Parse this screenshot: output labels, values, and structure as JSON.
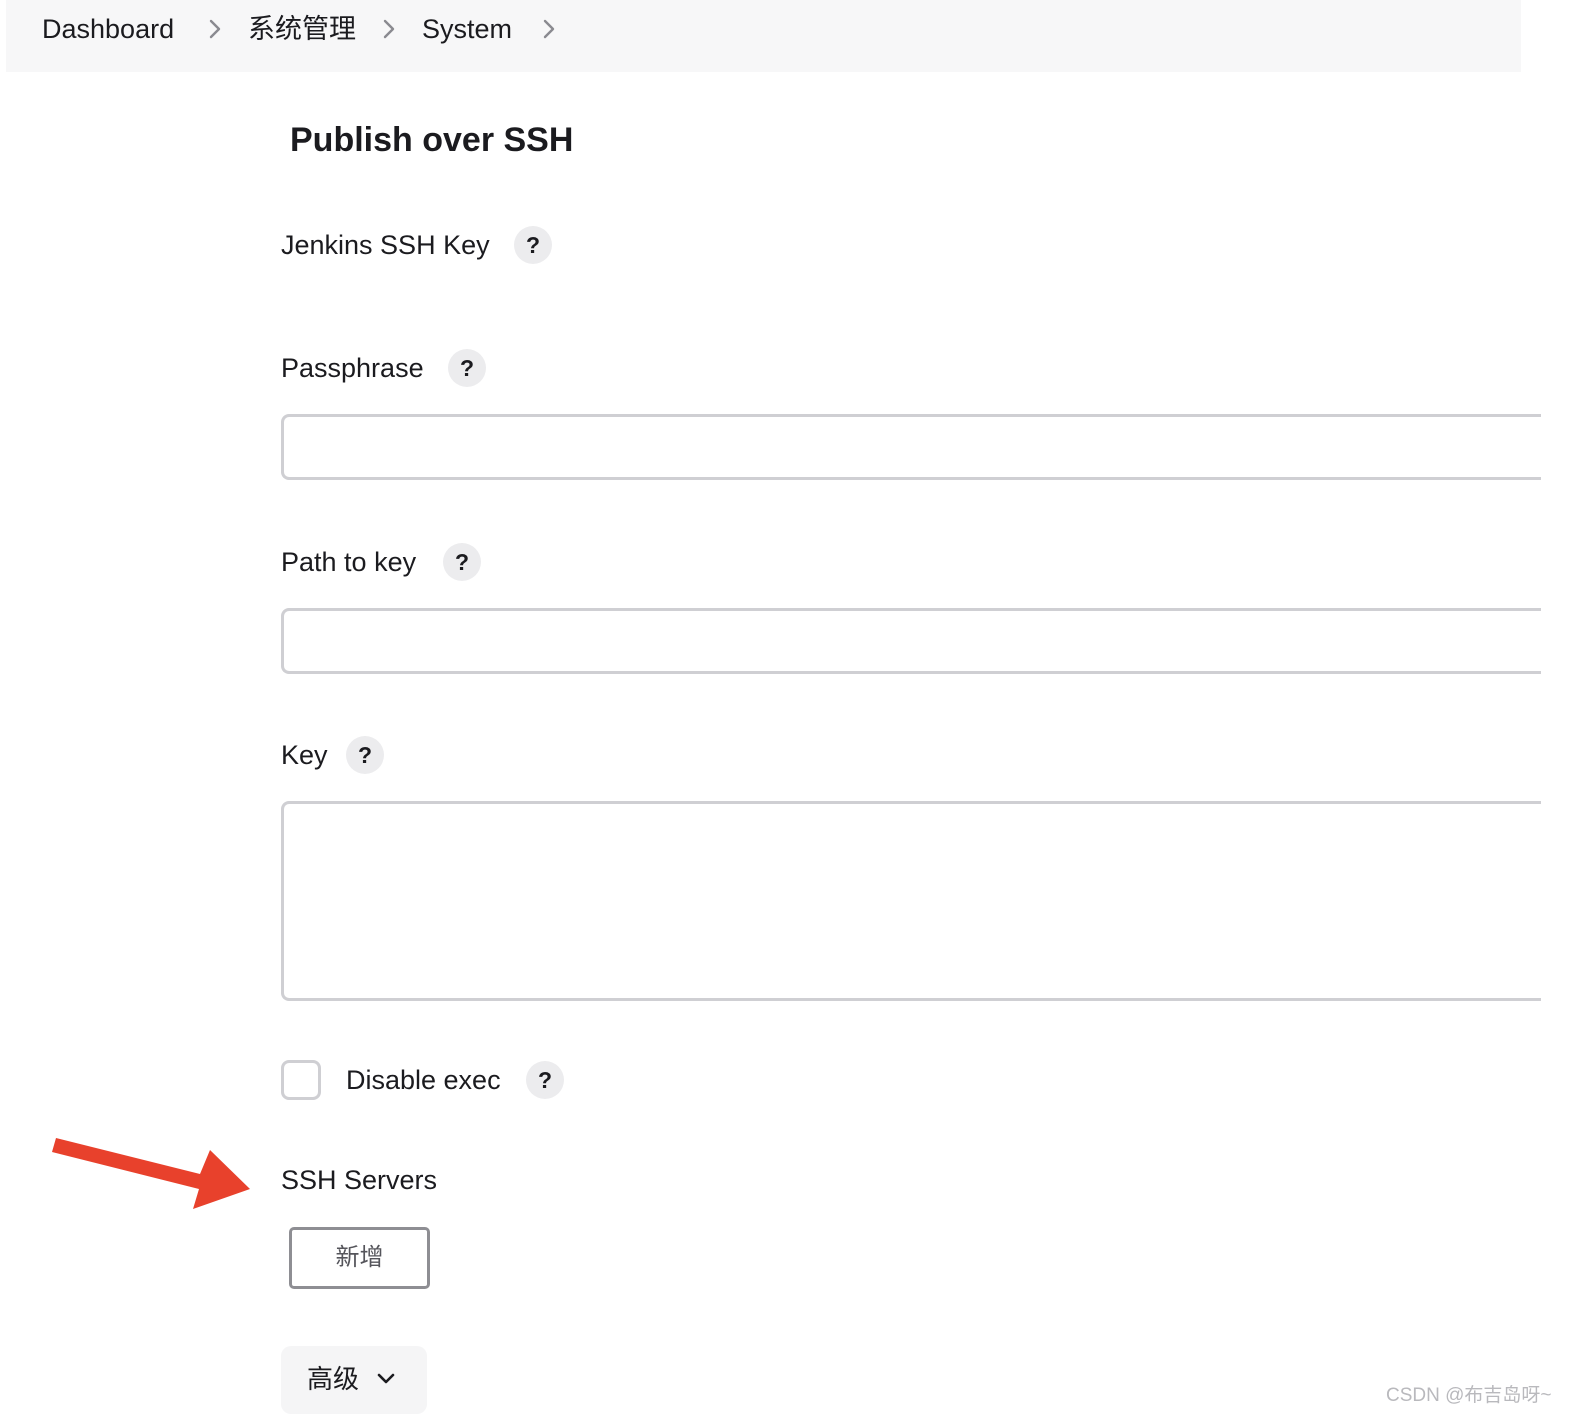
{
  "breadcrumb": {
    "items": [
      "Dashboard",
      "系统管理",
      "System"
    ]
  },
  "section": {
    "title": "Publish over SSH"
  },
  "fields": {
    "jenkins_ssh_key": {
      "label": "Jenkins SSH Key",
      "help": "?"
    },
    "passphrase": {
      "label": "Passphrase",
      "help": "?",
      "value": ""
    },
    "path_to_key": {
      "label": "Path to key",
      "help": "?",
      "value": ""
    },
    "key": {
      "label": "Key",
      "help": "?",
      "value": ""
    },
    "disable_exec": {
      "label": "Disable exec",
      "help": "?",
      "checked": false
    }
  },
  "ssh_servers": {
    "label": "SSH Servers",
    "add_button": "新增"
  },
  "advanced": {
    "label": "高级",
    "icon": "chevron-down-icon"
  },
  "annotation": {
    "icon": "red-arrow-icon",
    "color": "#e8412c"
  },
  "watermark": "CSDN @布吉岛呀~"
}
